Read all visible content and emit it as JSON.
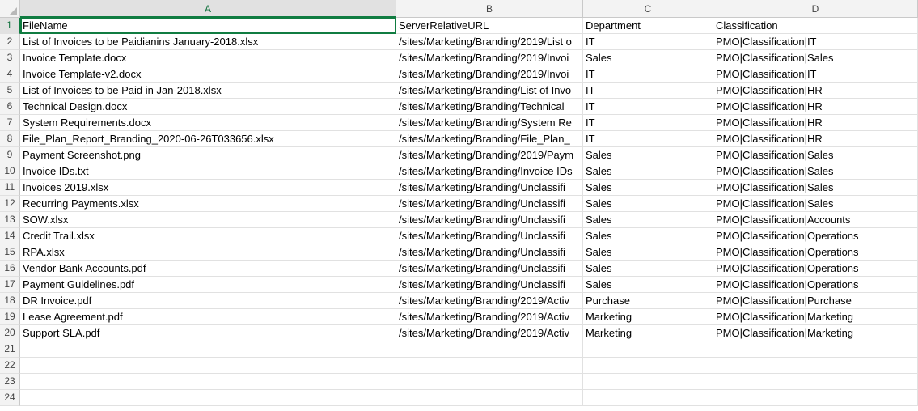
{
  "columns": [
    "A",
    "B",
    "C",
    "D"
  ],
  "selected_cell": "A1",
  "rows": [
    {
      "num": "1",
      "cells": [
        "FileName",
        "ServerRelativeURL",
        "Department",
        "Classification"
      ]
    },
    {
      "num": "2",
      "cells": [
        "List of Invoices to be Paidianins January-2018.xlsx",
        "/sites/Marketing/Branding/2019/List o",
        "IT",
        "PMO|Classification|IT"
      ]
    },
    {
      "num": "3",
      "cells": [
        "Invoice Template.docx",
        "/sites/Marketing/Branding/2019/Invoi",
        "Sales",
        "PMO|Classification|Sales"
      ]
    },
    {
      "num": "4",
      "cells": [
        "Invoice Template-v2.docx",
        "/sites/Marketing/Branding/2019/Invoi",
        "IT",
        "PMO|Classification|IT"
      ]
    },
    {
      "num": "5",
      "cells": [
        "List of Invoices to be Paid in Jan-2018.xlsx",
        "/sites/Marketing/Branding/List of Invo",
        "IT",
        "PMO|Classification|HR"
      ]
    },
    {
      "num": "6",
      "cells": [
        "Technical Design.docx",
        "/sites/Marketing/Branding/Technical",
        "IT",
        "PMO|Classification|HR"
      ]
    },
    {
      "num": "7",
      "cells": [
        "System Requirements.docx",
        "/sites/Marketing/Branding/System Re",
        "IT",
        "PMO|Classification|HR"
      ]
    },
    {
      "num": "8",
      "cells": [
        "File_Plan_Report_Branding_2020-06-26T033656.xlsx",
        "/sites/Marketing/Branding/File_Plan_",
        "IT",
        "PMO|Classification|HR"
      ]
    },
    {
      "num": "9",
      "cells": [
        "Payment Screenshot.png",
        "/sites/Marketing/Branding/2019/Paym",
        "Sales",
        "PMO|Classification|Sales"
      ]
    },
    {
      "num": "10",
      "cells": [
        "Invoice IDs.txt",
        "/sites/Marketing/Branding/Invoice IDs",
        "Sales",
        "PMO|Classification|Sales"
      ]
    },
    {
      "num": "11",
      "cells": [
        "Invoices 2019.xlsx",
        "/sites/Marketing/Branding/Unclassifi",
        "Sales",
        "PMO|Classification|Sales"
      ]
    },
    {
      "num": "12",
      "cells": [
        "Recurring Payments.xlsx",
        "/sites/Marketing/Branding/Unclassifi",
        "Sales",
        "PMO|Classification|Sales"
      ]
    },
    {
      "num": "13",
      "cells": [
        "SOW.xlsx",
        "/sites/Marketing/Branding/Unclassifi",
        "Sales",
        "PMO|Classification|Accounts"
      ]
    },
    {
      "num": "14",
      "cells": [
        "Credit Trail.xlsx",
        "/sites/Marketing/Branding/Unclassifi",
        "Sales",
        "PMO|Classification|Operations"
      ]
    },
    {
      "num": "15",
      "cells": [
        "RPA.xlsx",
        "/sites/Marketing/Branding/Unclassifi",
        "Sales",
        "PMO|Classification|Operations"
      ]
    },
    {
      "num": "16",
      "cells": [
        "Vendor Bank Accounts.pdf",
        "/sites/Marketing/Branding/Unclassifi",
        "Sales",
        "PMO|Classification|Operations"
      ]
    },
    {
      "num": "17",
      "cells": [
        "Payment Guidelines.pdf",
        "/sites/Marketing/Branding/Unclassifi",
        "Sales",
        "PMO|Classification|Operations"
      ]
    },
    {
      "num": "18",
      "cells": [
        "DR Invoice.pdf",
        "/sites/Marketing/Branding/2019/Activ",
        "Purchase",
        "PMO|Classification|Purchase"
      ]
    },
    {
      "num": "19",
      "cells": [
        "Lease Agreement.pdf",
        "/sites/Marketing/Branding/2019/Activ",
        "Marketing",
        "PMO|Classification|Marketing"
      ]
    },
    {
      "num": "20",
      "cells": [
        "Support SLA.pdf",
        "/sites/Marketing/Branding/2019/Activ",
        "Marketing",
        "PMO|Classification|Marketing"
      ]
    },
    {
      "num": "21",
      "cells": [
        "",
        "",
        "",
        ""
      ]
    },
    {
      "num": "22",
      "cells": [
        "",
        "",
        "",
        ""
      ]
    },
    {
      "num": "23",
      "cells": [
        "",
        "",
        "",
        ""
      ]
    },
    {
      "num": "24",
      "cells": [
        "",
        "",
        "",
        ""
      ]
    }
  ],
  "colors": {
    "accent": "#107c41",
    "header_bg": "#f3f3f3",
    "gridline": "#e1e1e1"
  }
}
